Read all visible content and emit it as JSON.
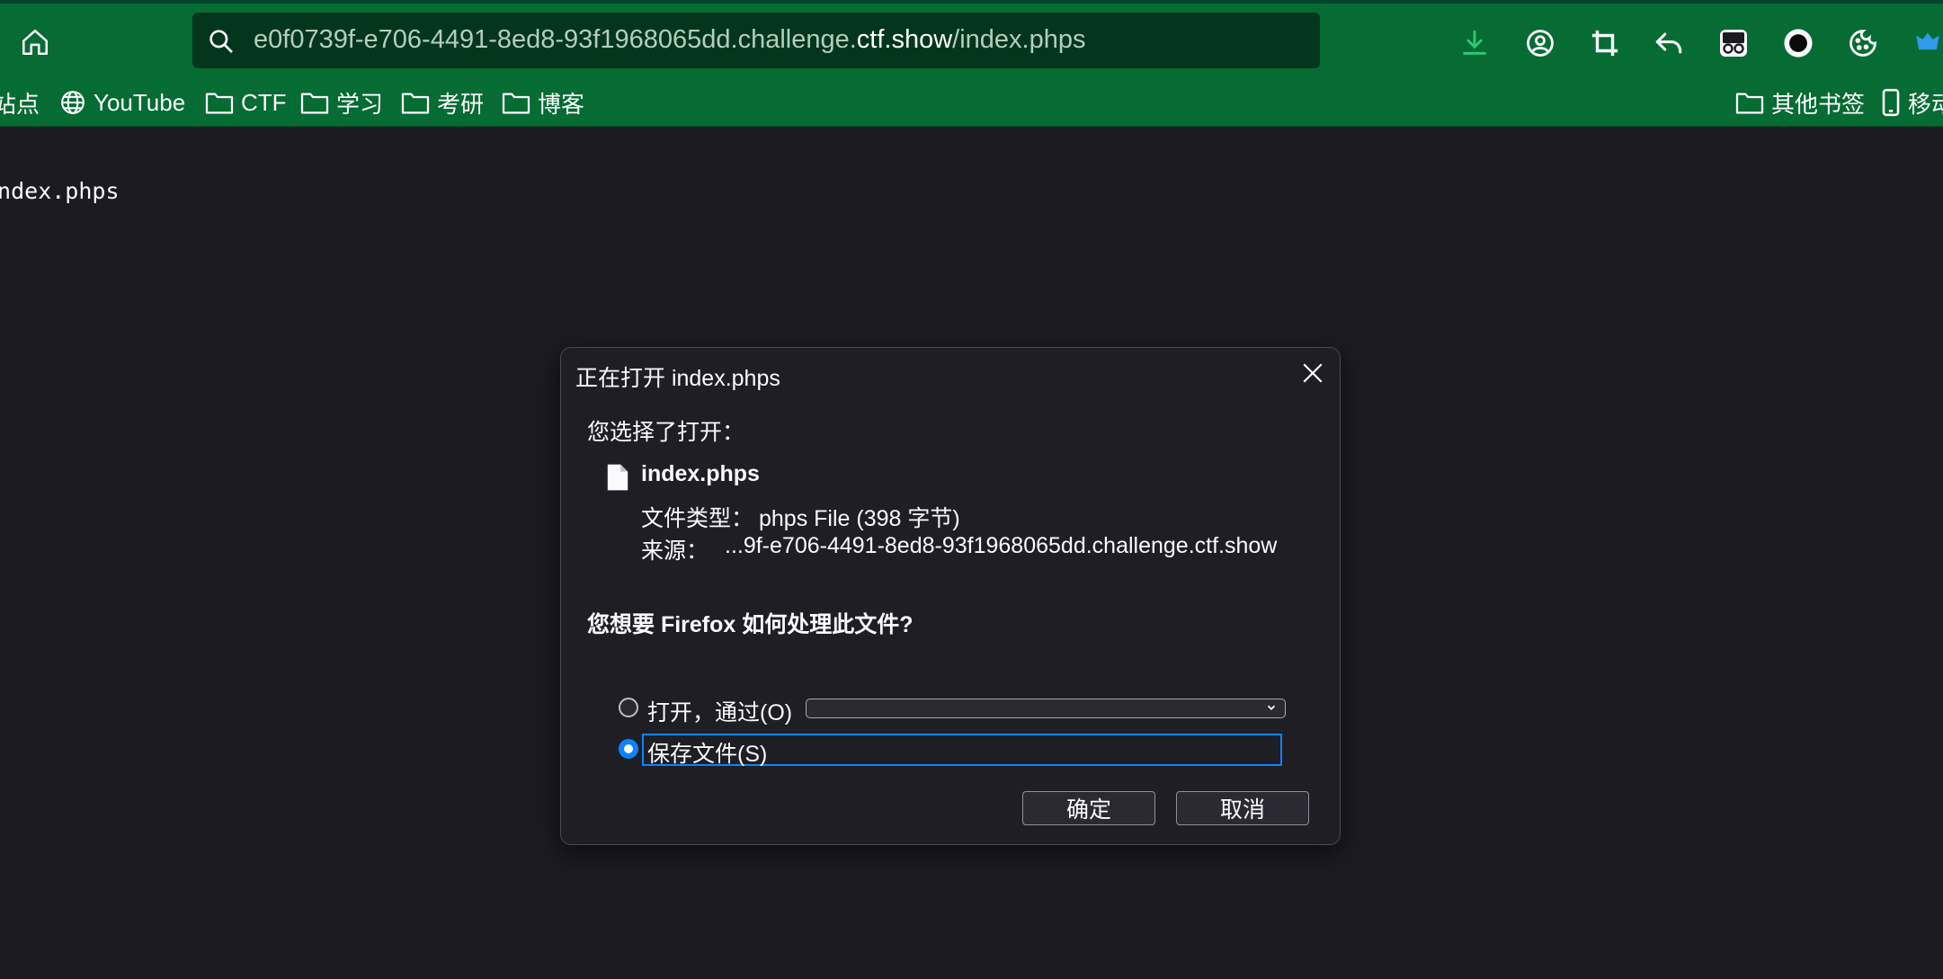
{
  "toolbar": {
    "url_prefix": "e0f0739f-e706-4491-8ed8-93f1968065dd.challenge.",
    "url_domain": "ctf.show",
    "url_path": "/index.phps",
    "icons": [
      "home-icon",
      "search-icon",
      "download-icon",
      "account-icon",
      "crop-icon",
      "undo-icon",
      "glasses-icon",
      "record-icon",
      "cookie-icon",
      "extension-icon"
    ],
    "download_icon_color": "#2ecc71"
  },
  "bookmarks": {
    "items": [
      {
        "label": "站点",
        "icon": "folder-icon"
      },
      {
        "label": "YouTube",
        "icon": "globe-icon"
      },
      {
        "label": "CTF",
        "icon": "folder-icon"
      },
      {
        "label": "学习",
        "icon": "folder-icon"
      },
      {
        "label": "考研",
        "icon": "folder-icon"
      },
      {
        "label": "博客",
        "icon": "folder-icon"
      }
    ],
    "other": "其他书签",
    "mobile": "移动"
  },
  "page": {
    "text": "index.phps"
  },
  "dialog": {
    "title": "正在打开 index.phps",
    "chosen_label": "您选择了打开：",
    "file_name": "index.phps",
    "type_label": "文件类型：",
    "type_value": "phps File (398 字节)",
    "source_label": "来源：",
    "source_value": "...9f-e706-4491-8ed8-93f1968065dd.challenge.ctf.show",
    "question": "您想要 Firefox 如何处理此文件?",
    "open_with_label": "打开，通过(O)",
    "open_with_value": "",
    "save_label": "保存文件(S)",
    "selected_option": "save",
    "ok_label": "确定",
    "cancel_label": "取消"
  }
}
